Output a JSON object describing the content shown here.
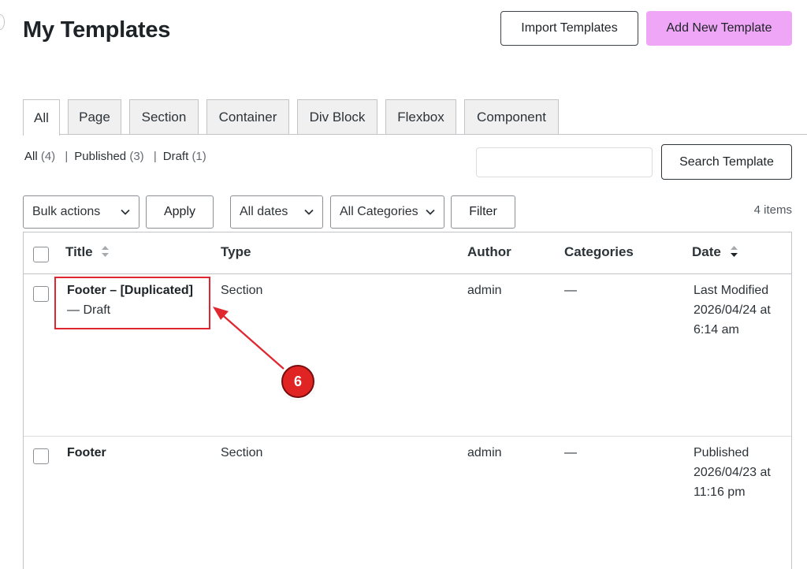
{
  "header": {
    "title": "My Templates",
    "import_label": "Import Templates",
    "add_label": "Add New Template"
  },
  "tabs": [
    {
      "label": "All",
      "active": true
    },
    {
      "label": "Page"
    },
    {
      "label": "Section"
    },
    {
      "label": "Container"
    },
    {
      "label": "Div Block"
    },
    {
      "label": "Flexbox"
    },
    {
      "label": "Component"
    }
  ],
  "status_filter": {
    "all_label": "All",
    "all_count": "(4)",
    "published_label": "Published",
    "published_count": "(3)",
    "draft_label": "Draft",
    "draft_count": "(1)",
    "separator": "|"
  },
  "search": {
    "placeholder": "",
    "button_label": "Search Template"
  },
  "toolbar": {
    "bulk_actions": "Bulk actions",
    "apply_label": "Apply",
    "dates": "All dates",
    "categories": "All Categories",
    "filter_label": "Filter",
    "items_count": "4 items"
  },
  "table": {
    "columns": {
      "title": "Title",
      "type": "Type",
      "author": "Author",
      "categories": "Categories",
      "date": "Date"
    },
    "rows": [
      {
        "title": "Footer – [Duplicated]",
        "state": "— Draft",
        "type": "Section",
        "author": "admin",
        "categories": "—",
        "date_status": "Last Modified",
        "date_value": "2026/04/24 at",
        "date_time": "6:14 am"
      },
      {
        "title": "Footer",
        "state": "",
        "type": "Section",
        "author": "admin",
        "categories": "—",
        "date_status": "Published",
        "date_value": "2026/04/23 at",
        "date_time": "11:16 pm"
      }
    ]
  },
  "annotation": {
    "step_number": "6",
    "color": "#e02424"
  },
  "colors": {
    "accent_button": "#f0a6f6",
    "annotation_red": "#e02424"
  }
}
